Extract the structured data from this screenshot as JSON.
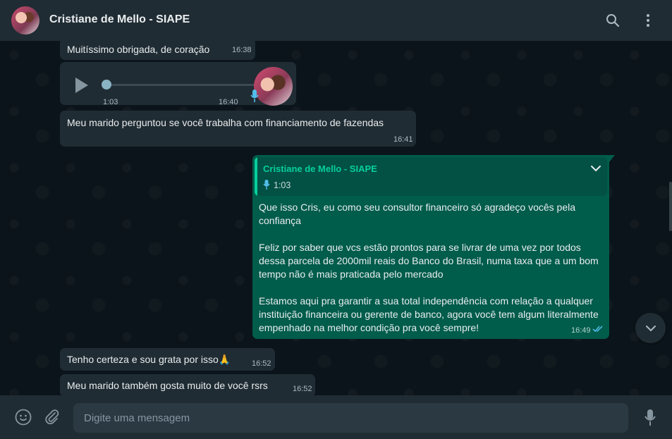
{
  "header": {
    "title": "Cristiane de Mello - SIAPE",
    "icons": [
      "search-icon",
      "menu-dots-icon"
    ]
  },
  "messages": [
    {
      "type": "in-text",
      "text": "Muitíssimo obrigada, de coração",
      "time": "16:38"
    },
    {
      "type": "in-audio",
      "duration": "1:03",
      "time": "16:40"
    },
    {
      "type": "in-text",
      "text": "Meu marido perguntou se você trabalha com financiamento de fazendas",
      "time": "16:41"
    },
    {
      "type": "out-text",
      "quote": {
        "name": "Cristiane de Mello - SIAPE",
        "duration": "1:03"
      },
      "paragraphs": [
        "Que isso Cris, eu como seu consultor financeiro só agradeço vocês pela confiança",
        "Feliz por saber que vcs estão prontos para se livrar de uma vez por todos dessa parcela de 2000mil reais do Banco do Brasil, numa taxa que a um bom tempo não é mais praticada pelo mercado",
        "Estamos aqui pra garantir a sua total independência com relação a qualquer instituição financeira ou gerente de banco, agora você tem algum literalmente empenhado na melhor condição pra você sempre!"
      ],
      "time": "16:49",
      "status": "read"
    },
    {
      "type": "in-text",
      "text": "Tenho certeza e sou grata por isso🙏",
      "time": "16:52"
    },
    {
      "type": "in-text",
      "text": "Meu marido também gosta muito de você rsrs",
      "time": "16:52"
    }
  ],
  "composer": {
    "placeholder": "Digite uma mensagem",
    "icons": [
      "emoji-icon",
      "attach-icon",
      "microphone-icon"
    ]
  },
  "colors": {
    "header_bg": "#202c33",
    "chat_bg": "#0b141a",
    "incoming_bubble": "#202c33",
    "outgoing_bubble": "#005c4b",
    "accent": "#06cf9c",
    "read_ticks": "#53bdeb"
  }
}
